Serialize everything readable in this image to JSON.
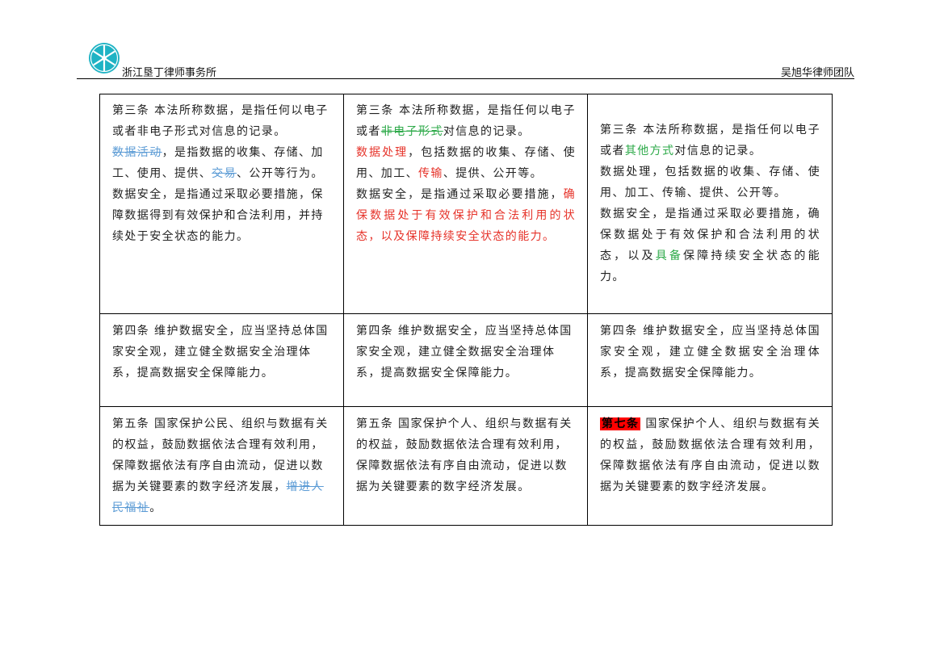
{
  "header": {
    "firm_left": "浙江垦丁律师事务所",
    "firm_right": "吴旭华律师团队",
    "logo_color": "#1fb3c4"
  },
  "colors": {
    "deleted_blue": "#5b9bd5",
    "deleted_green": "#2eaa4a",
    "inserted_red": "#e6332a",
    "inserted_green": "#2eaa4a",
    "highlight_red": "#ff0000"
  },
  "rows": [
    {
      "col1": {
        "p1": "第三条 本法所称数据，是指任何以电子或者非电子形式对信息的记录。",
        "p2_del1": "数据活动",
        "p2_a": "，是指数据的收集、存储、加工、使用、提供、",
        "p2_del2": "交易",
        "p2_b": "、公开等行为。",
        "p3": "数据安全，是指通过采取必要措施，保障数据得到有效保护和合法利用，并持续处于安全状态的能力。"
      },
      "col2": {
        "p1_a": "第三条 本法所称数据，是指任何以电子或者",
        "p1_del": "非电子形式",
        "p1_b": "对信息的记录。",
        "p2_ins1": "数据处理",
        "p2_a": "，包括数据的收集、存储、使用、加工、",
        "p2_ins2": "传输",
        "p2_b": "、提供、公开等。",
        "p3_a": "数据安全，是指通过采取必要措施，",
        "p3_ins": "确保数据处于有效保护和合法利用的状态，以及保障持续安全状态的能力。"
      },
      "col3": {
        "p1_a": "第三条 本法所称数据，是指任何以电子或者",
        "p1_ins": "其他方式",
        "p1_b": "对信息的记录。",
        "p2": "数据处理，包括数据的收集、存储、使用、加工、传输、提供、公开等。",
        "p3_a": "数据安全，是指通过采取必要措施，确保数据处于有效保护和合法利用的状态，以及",
        "p3_ins": "具备",
        "p3_b": "保障持续安全状态的能力。"
      }
    },
    {
      "col1": {
        "text": "第四条 维护数据安全，应当坚持总体国家安全观，建立健全数据安全治理体系，提高数据安全保障能力。"
      },
      "col2": {
        "text": "第四条 维护数据安全，应当坚持总体国家安全观，建立健全数据安全治理体系，提高数据安全保障能力。"
      },
      "col3": {
        "text": "第四条 维护数据安全，应当坚持总体国家安全观，建立健全数据安全治理体系，提高数据安全保障能力。"
      }
    },
    {
      "col1": {
        "text": "第五条 国家保护公民、组织与数据有关的权益，鼓励数据依法合理有效利用，保障数据依法有序自由流动，促进以数据为关键要素的数字经济发展，",
        "del": "增进人民福祉",
        "end": "。"
      },
      "col2": {
        "text": "第五条 国家保护个人、组织与数据有关的权益，鼓励数据依法合理有效利用，保障数据依法有序自由流动，促进以数据为关键要素的数字经济发展。"
      },
      "col3": {
        "hl": "第七条",
        "text": " 国家保护个人、组织与数据有关的权益，鼓励数据依法合理有效利用，保障数据依法有序自由流动，促进以数据为关键要素的数字经济发展。"
      }
    }
  ]
}
